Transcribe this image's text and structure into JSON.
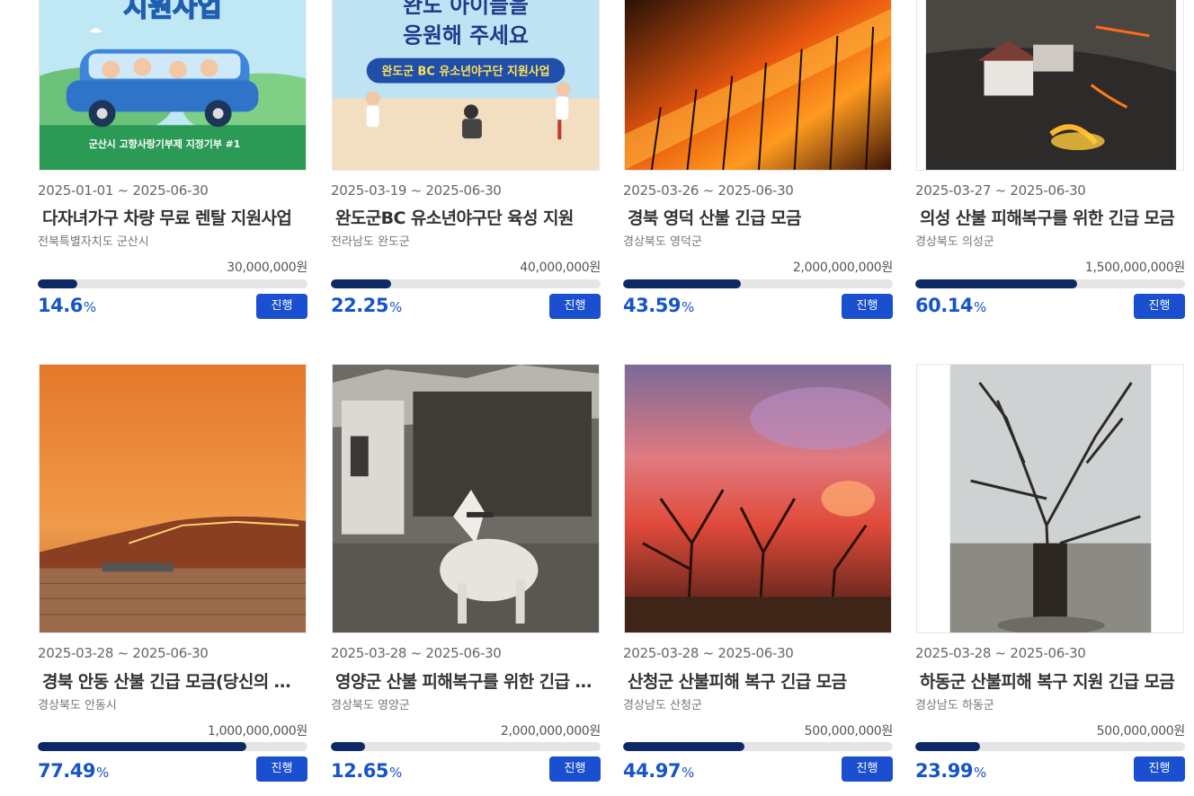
{
  "cards": [
    {
      "period": "2025-01-01 ~ 2025-06-30",
      "title": "다자녀가구 차량 무료 렌탈 지원사업",
      "region": "전북특별자치도 군산시",
      "goal": "30,000,000원",
      "percent": "14.6",
      "percent_value": 14.6,
      "status": "진행",
      "image_text": [
        "지원사업",
        "군산시 고향사랑기부제 지정기부 #1"
      ]
    },
    {
      "period": "2025-03-19 ~ 2025-06-30",
      "title": "완도군BC 유소년야구단 육성 지원",
      "region": "전라남도 완도군",
      "goal": "40,000,000원",
      "percent": "22.25",
      "percent_value": 22.25,
      "status": "진행",
      "image_text": [
        "완도 아이들을",
        "응원해 주세요",
        "완도군 BC 유소년야구단 지원사업"
      ]
    },
    {
      "period": "2025-03-26 ~ 2025-06-30",
      "title": "경북 영덕 산불 긴급 모금",
      "region": "경상북도 영덕군",
      "goal": "2,000,000,000원",
      "percent": "43.59",
      "percent_value": 43.59,
      "status": "진행",
      "image_text": []
    },
    {
      "period": "2025-03-27 ~ 2025-06-30",
      "title": "의성 산불 피해복구를 위한 긴급 모금",
      "region": "경상북도 의성군",
      "goal": "1,500,000,000원",
      "percent": "60.14",
      "percent_value": 60.14,
      "status": "진행",
      "image_text": []
    },
    {
      "period": "2025-03-28 ~ 2025-06-30",
      "title": "경북 안동 산불 긴급 모금(당신의 작은 손길이 큰 힘이 됩니다)",
      "region": "경상북도 안동시",
      "goal": "1,000,000,000원",
      "percent": "77.49",
      "percent_value": 77.49,
      "status": "진행",
      "image_text": []
    },
    {
      "period": "2025-03-28 ~ 2025-06-30",
      "title": "영양군 산불 피해복구를 위한 긴급 모금",
      "region": "경상북도 영양군",
      "goal": "2,000,000,000원",
      "percent": "12.65",
      "percent_value": 12.65,
      "status": "진행",
      "image_text": []
    },
    {
      "period": "2025-03-28 ~ 2025-06-30",
      "title": "산청군 산불피해 복구 긴급 모금",
      "region": "경상남도 산청군",
      "goal": "500,000,000원",
      "percent": "44.97",
      "percent_value": 44.97,
      "status": "진행",
      "image_text": []
    },
    {
      "period": "2025-03-28 ~ 2025-06-30",
      "title": "하동군 산불피해 복구 지원 긴급 모금",
      "region": "경상남도 하동군",
      "goal": "500,000,000원",
      "percent": "23.99",
      "percent_value": 23.99,
      "status": "진행",
      "image_text": []
    }
  ],
  "percent_unit": "%",
  "colors": {
    "progress_fill": "#0d2a66",
    "progress_track": "#e5e5e5",
    "percent_text": "#1655c8",
    "status_button": "#1a4fd0"
  }
}
